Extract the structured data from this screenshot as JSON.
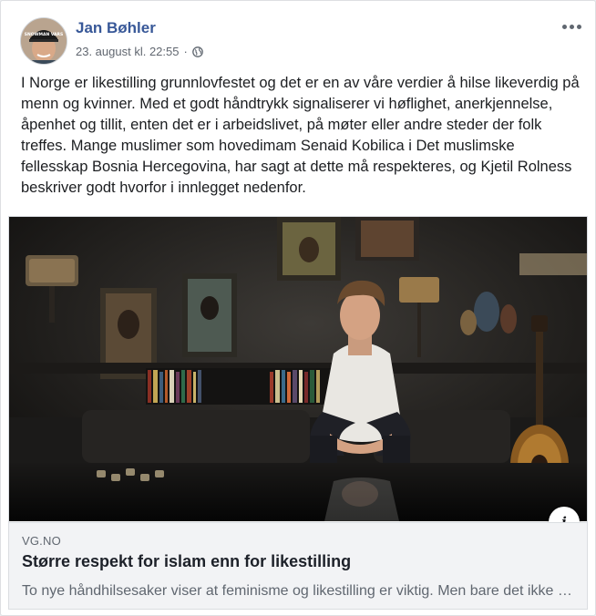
{
  "post": {
    "author_name": "Jan Bøhler",
    "timestamp": "23. august kl. 22:55",
    "separator": "·",
    "privacy_icon": "globe-icon",
    "more_icon": "more-options-icon",
    "avatar_cap_text": "SNOWMAN VARS",
    "text": "I Norge er likestilling grunnlovfestet og det er en av våre verdier å hilse likeverdig på menn og kvinner. Med et godt håndtrykk signaliserer vi høflighet, anerkjennelse, åpenhet og tillit, enten det er i arbeidslivet, på møter eller andre steder der folk treffes. Mange muslimer som hovedimam Senaid Kobilica i Det muslimske fellesskap Bosnia Hercegovina, har sagt at dette må respekteres, og Kjetil Rolness beskriver godt hvorfor i innlegget nedenfor."
  },
  "link_preview": {
    "domain": "VG.NO",
    "headline": "Større respekt for islam enn for likestilling",
    "description": "To nye håndhilsesaker viser at feminisme og likestilling er viktig. Men bare det ikke støter an mot islam.",
    "info_label": "i",
    "info_icon": "info-icon"
  },
  "colors": {
    "link_blue": "#385898",
    "text": "#1c1e21",
    "muted": "#606770",
    "card_bg": "#f2f3f5"
  }
}
